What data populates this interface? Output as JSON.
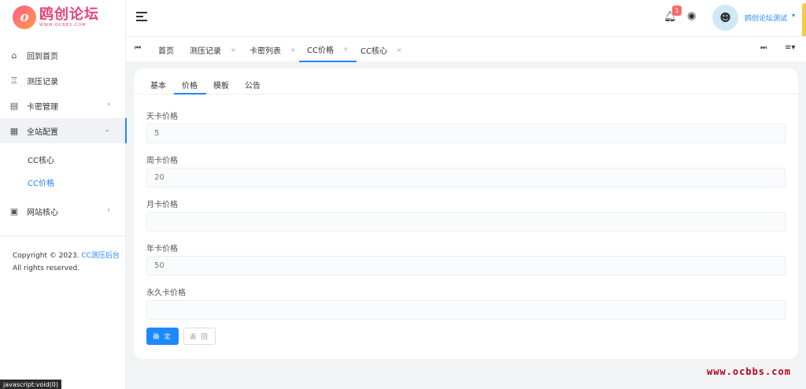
{
  "brand": {
    "title": "鸥创论坛",
    "subtitle": "WWW.OCBBS.COM",
    "mark": "o"
  },
  "sidebar": {
    "items": [
      {
        "label": "回到首页",
        "icon": "home-icon"
      },
      {
        "label": "测压记录",
        "icon": "record-icon"
      },
      {
        "label": "卡密管理",
        "icon": "card-icon"
      },
      {
        "label": "全站配置",
        "icon": "calendar-icon"
      },
      {
        "label": "网站核心",
        "icon": "document-icon"
      }
    ],
    "sub_items": [
      {
        "label": "CC核心"
      },
      {
        "label": "CC价格"
      }
    ],
    "copyright_prefix": "Copyright © 2023.",
    "copyright_link": "CC测压后台",
    "copyright_suffix": "All rights reserved."
  },
  "header": {
    "notification_count": "1",
    "username": "鸥创论坛测试"
  },
  "tabs": [
    {
      "label": "首页"
    },
    {
      "label": "测压记录"
    },
    {
      "label": "卡密列表"
    },
    {
      "label": "CC价格"
    },
    {
      "label": "CC核心"
    }
  ],
  "card_tabs": [
    {
      "label": "基本"
    },
    {
      "label": "价格"
    },
    {
      "label": "模板"
    },
    {
      "label": "公告"
    }
  ],
  "fields": [
    {
      "label": "天卡价格",
      "value": "5"
    },
    {
      "label": "周卡价格",
      "value": "20"
    },
    {
      "label": "月卡价格",
      "value": ""
    },
    {
      "label": "年卡价格",
      "value": "50"
    },
    {
      "label": "永久卡价格",
      "value": ""
    }
  ],
  "buttons": {
    "ok": "确 定",
    "back": "返 回"
  },
  "watermark": "www.ocbbs.com",
  "status_bar": "javascript:void(0)",
  "colors": {
    "accent": "#1e88ff",
    "brand": "#e8427a",
    "badge": "#f56c6c",
    "watermark": "#b8001f"
  }
}
